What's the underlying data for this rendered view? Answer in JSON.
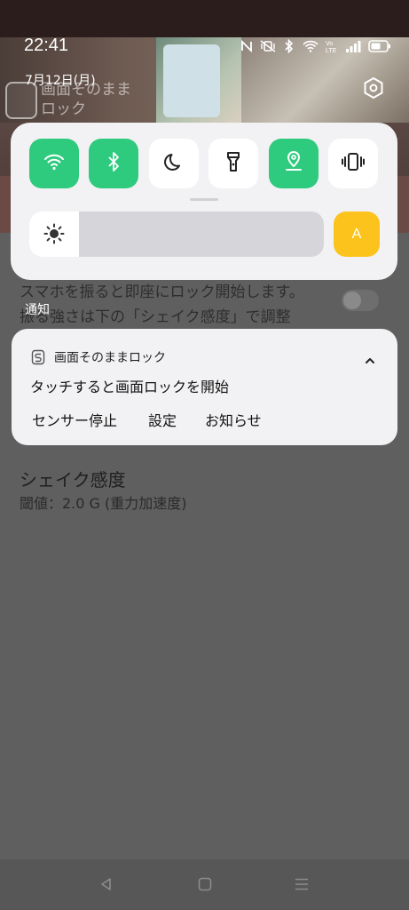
{
  "status_bar": {
    "time": "22:41",
    "icons": [
      "nfc-icon",
      "mute-vibrate-icon",
      "bluetooth-icon",
      "wifi-icon",
      "volte-icon",
      "signal-icon",
      "battery-icon"
    ]
  },
  "header": {
    "date": "7月12日(月)",
    "app_title": "画面そのまま\nロック"
  },
  "quick_settings": {
    "tiles": [
      {
        "name": "wifi",
        "icon": "wifi-icon",
        "active": true
      },
      {
        "name": "bluetooth",
        "icon": "bluetooth-icon",
        "active": true
      },
      {
        "name": "do-not-disturb",
        "icon": "moon-icon",
        "active": false
      },
      {
        "name": "flashlight",
        "icon": "flashlight-icon",
        "active": false
      },
      {
        "name": "location",
        "icon": "location-icon",
        "active": true
      },
      {
        "name": "vibrate",
        "icon": "vibrate-icon",
        "active": false
      }
    ],
    "brightness_level": 0,
    "auto_label": "A",
    "colors": {
      "active": "#2ecb7e",
      "auto": "#fcc31c"
    }
  },
  "background": {
    "description_line1": "スマホを振ると即座にロック開始します。",
    "description_line2": "振る強さは下の「シェイク感度」で調整",
    "shake_title": "シェイク感度",
    "shake_value": "閾値：2.0 G (重力加速度)"
  },
  "notifications": {
    "header": "通知",
    "card": {
      "app_name": "画面そのままロック",
      "body": "タッチすると画面ロックを開始",
      "actions": [
        "センサー停止",
        "設定",
        "お知らせ"
      ]
    }
  },
  "nav_bar": {
    "buttons": [
      "back-icon",
      "home-icon",
      "recents-icon"
    ]
  }
}
